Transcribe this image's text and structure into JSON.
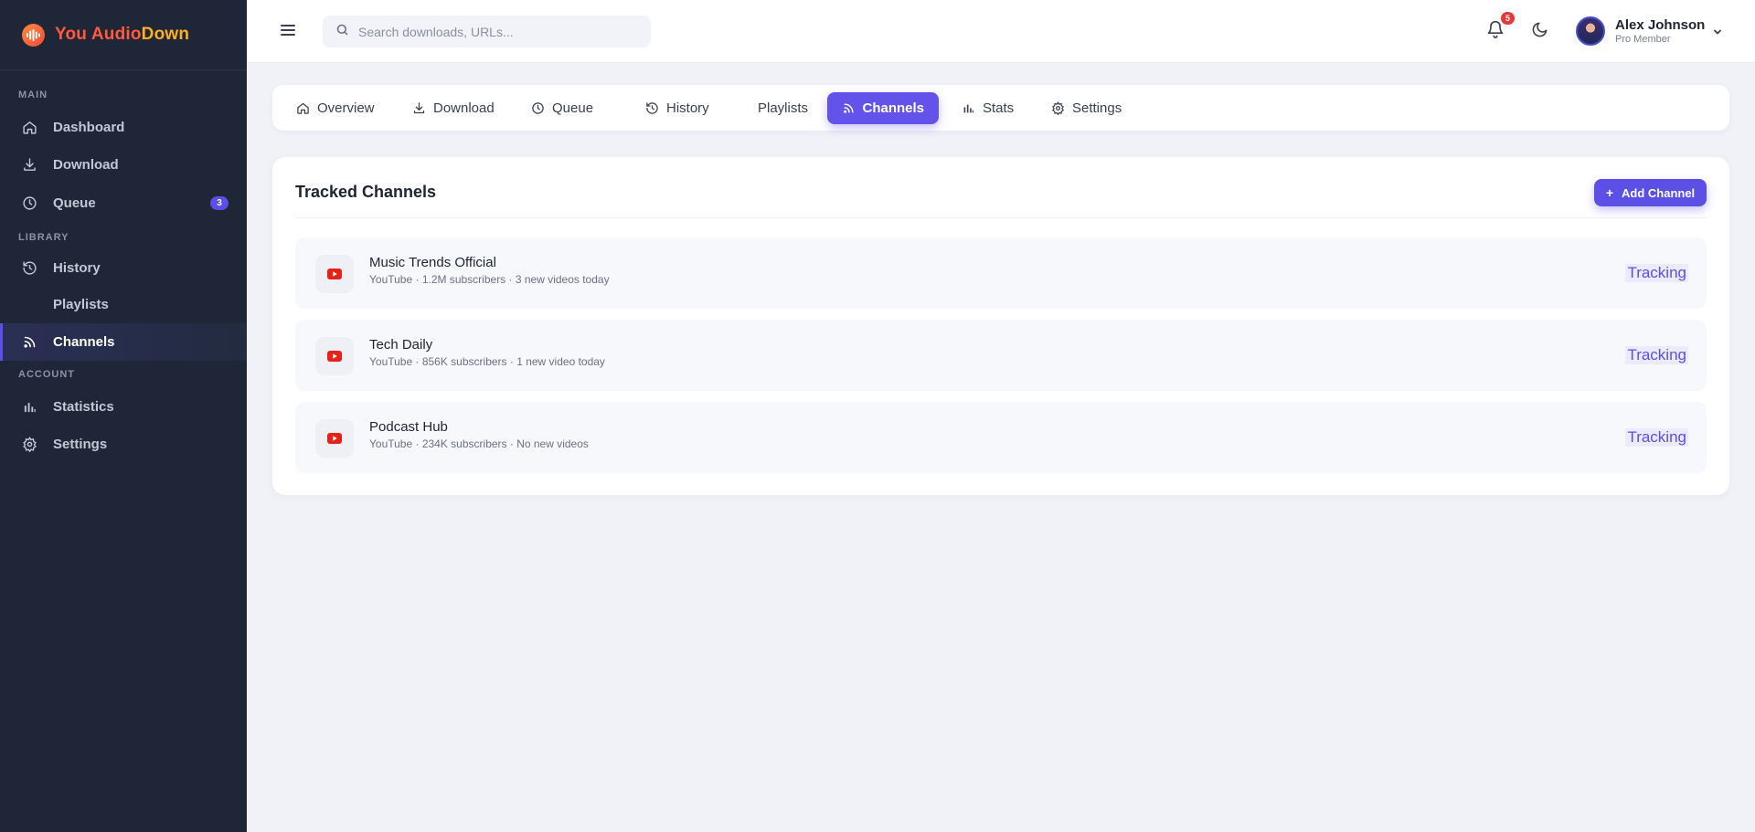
{
  "app": {
    "brand_part1": "You Audio",
    "brand_part2": "Down",
    "accent_color": "#5b4fe6"
  },
  "sidebar": {
    "sections": {
      "main": "MAIN",
      "library": "LIBRARY",
      "account": "ACCOUNT"
    },
    "items": [
      {
        "label": "Dashboard",
        "icon": "home-icon"
      },
      {
        "label": "Download",
        "icon": "download-icon"
      },
      {
        "label": "Queue",
        "icon": "clock-icon",
        "badge": "3"
      },
      {
        "label": "History",
        "icon": "history-icon"
      },
      {
        "label": "Playlists",
        "icon": ""
      },
      {
        "label": "Channels",
        "icon": "rss-icon",
        "active": true
      },
      {
        "label": "Statistics",
        "icon": "bar-chart-icon"
      },
      {
        "label": "Settings",
        "icon": "gear-icon"
      }
    ]
  },
  "header": {
    "search_placeholder": "Search downloads, URLs...",
    "notification_count": "5",
    "user": {
      "name": "Alex Johnson",
      "role": "Pro Member"
    }
  },
  "tabs": [
    {
      "label": "Overview",
      "icon": "home-icon"
    },
    {
      "label": "Download",
      "icon": "download-icon"
    },
    {
      "label": "Queue",
      "icon": "clock-icon"
    },
    {
      "label": "History",
      "icon": "history-icon"
    },
    {
      "label": "Playlists",
      "icon": ""
    },
    {
      "label": "Channels",
      "icon": "rss-icon",
      "active": true
    },
    {
      "label": "Stats",
      "icon": "bar-chart-icon"
    },
    {
      "label": "Settings",
      "icon": "gear-icon"
    }
  ],
  "main": {
    "title": "Tracked Channels",
    "add_button": "Add Channel",
    "channels": [
      {
        "name": "Music Trends Official",
        "meta": "YouTube · 1.2M subscribers · 3 new videos today",
        "status": "Tracking"
      },
      {
        "name": "Tech Daily",
        "meta": "YouTube · 856K subscribers · 1 new video today",
        "status": "Tracking"
      },
      {
        "name": "Podcast Hub",
        "meta": "YouTube · 234K subscribers · No new videos",
        "status": "Tracking"
      }
    ]
  }
}
